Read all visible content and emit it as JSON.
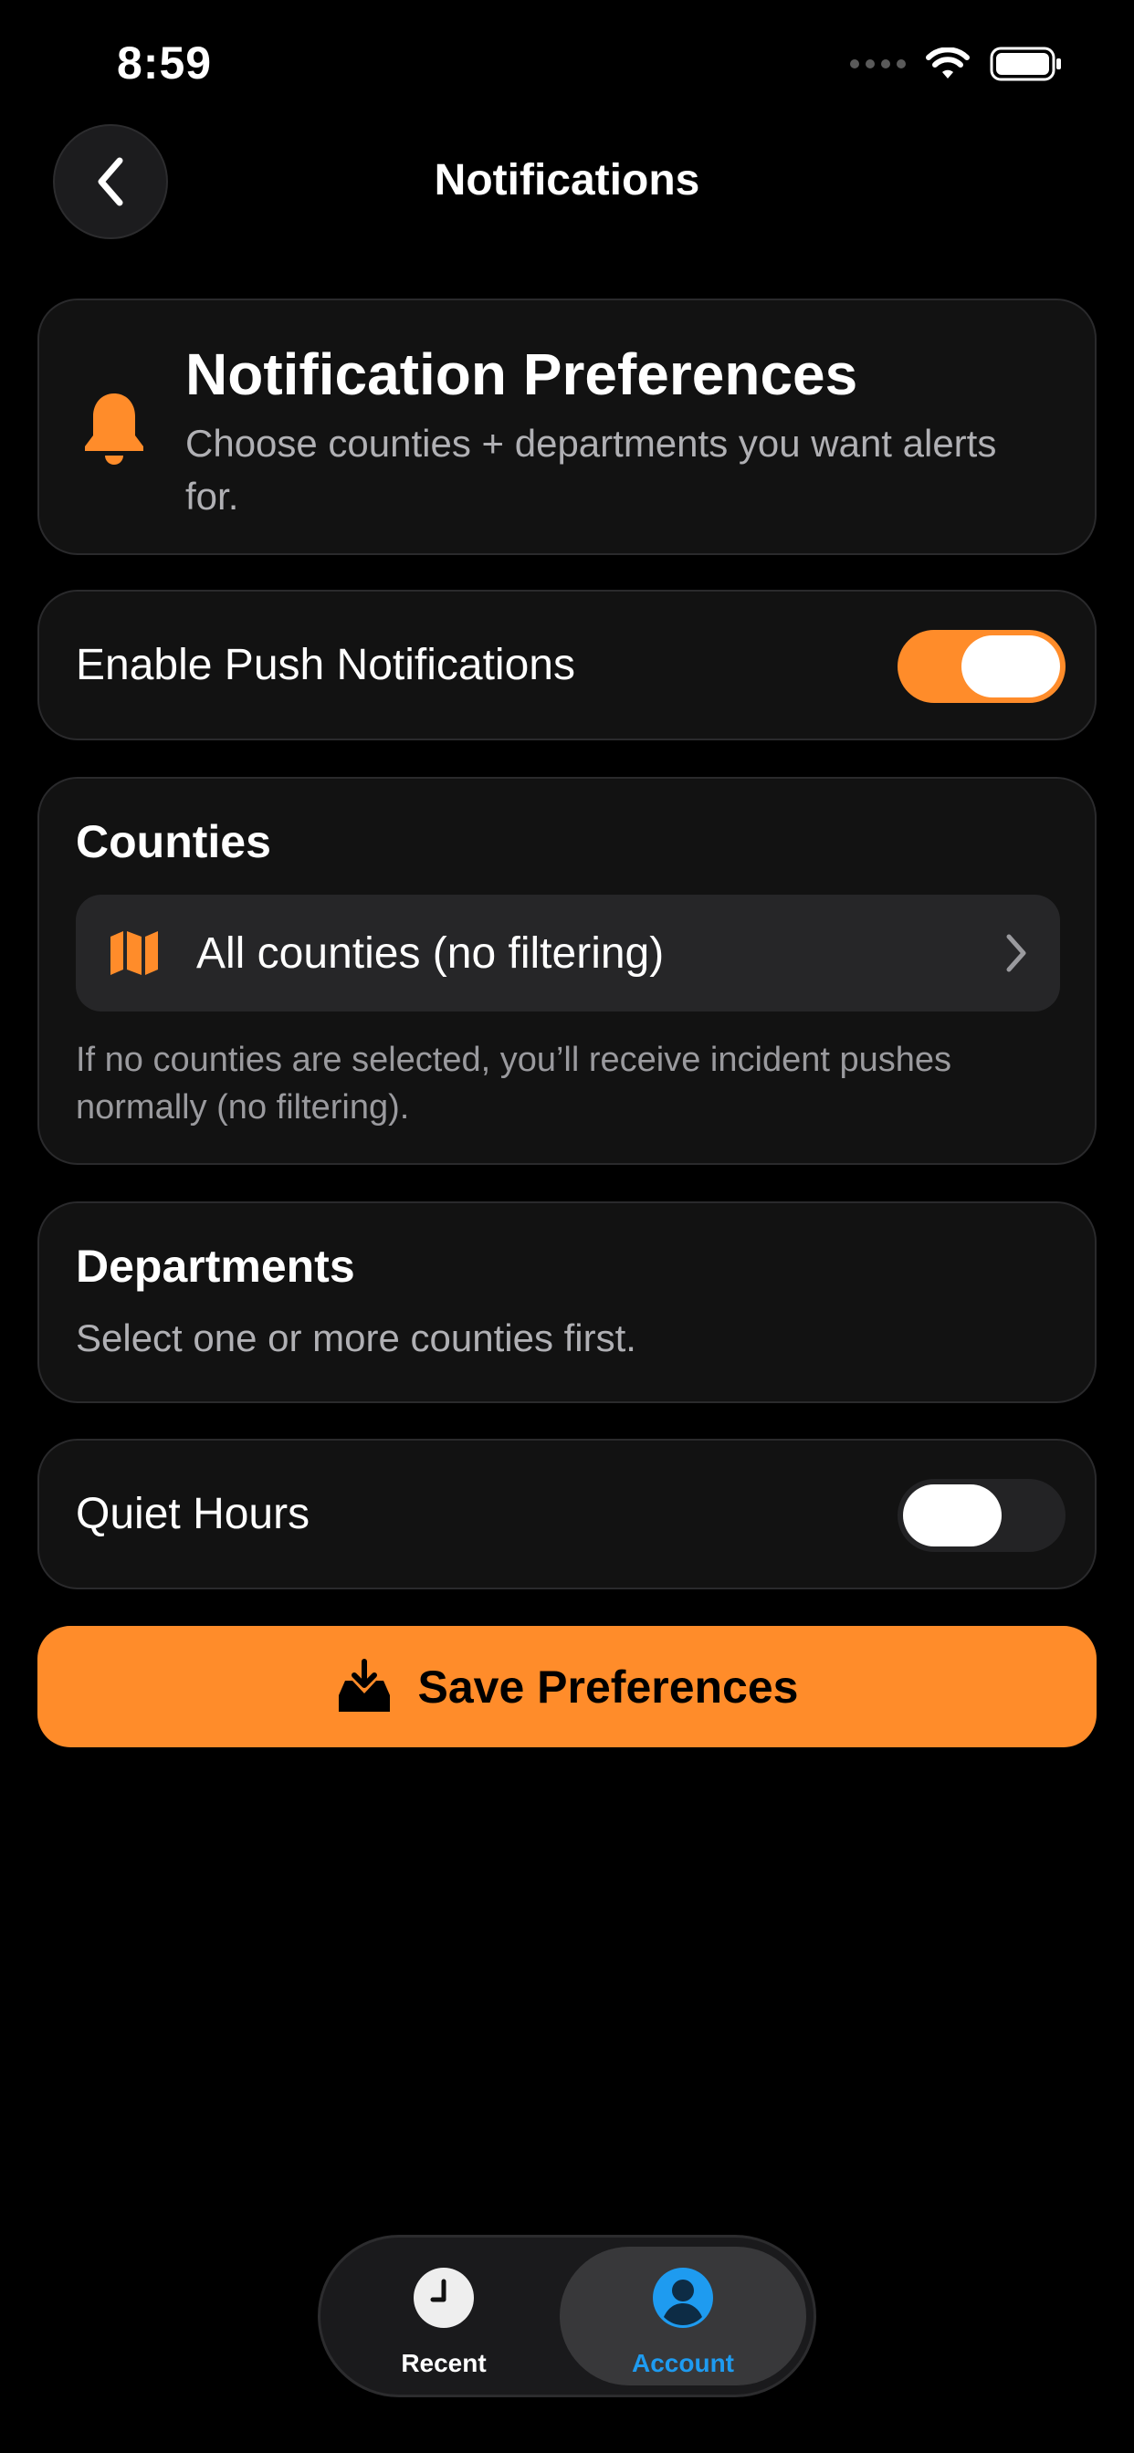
{
  "status_bar": {
    "time": "8:59"
  },
  "header": {
    "title": "Notifications",
    "back_icon": "chevron-left-icon"
  },
  "preferences": {
    "title": "Notification Preferences",
    "subtitle": "Choose counties + departments you want alerts for.",
    "icon": "bell-icon"
  },
  "push": {
    "label": "Enable Push Notifications",
    "enabled": true
  },
  "counties": {
    "title": "Counties",
    "select_label": "All counties (no filtering)",
    "note": "If no counties are selected, you’ll receive incident pushes normally (no filtering).",
    "icon": "map-icon"
  },
  "departments": {
    "title": "Departments",
    "note": "Select one or more counties first."
  },
  "quiet_hours": {
    "label": "Quiet Hours",
    "enabled": false
  },
  "save": {
    "label": "Save Preferences",
    "icon": "tray-download-icon"
  },
  "tabs": [
    {
      "label": "Recent",
      "icon": "clock-icon",
      "active": false
    },
    {
      "label": "Account",
      "icon": "person-circle-icon",
      "active": true
    }
  ],
  "colors": {
    "accent": "#ff8c2a",
    "active_tab": "#1e9bf0",
    "background": "#000000",
    "card": "#121212"
  }
}
